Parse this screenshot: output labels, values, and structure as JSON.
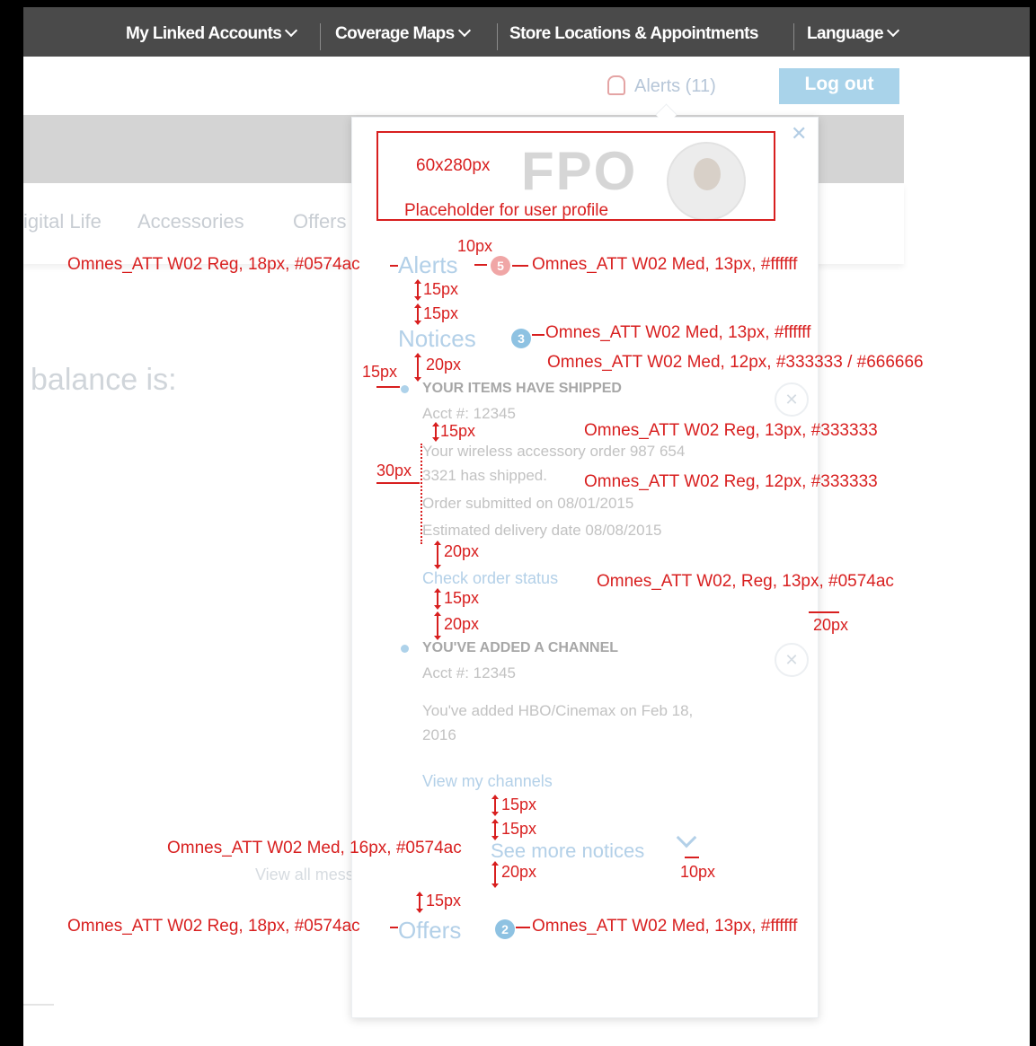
{
  "nav": {
    "linked_accounts": "My Linked Accounts",
    "coverage_maps": "Coverage Maps",
    "store_locations": "Store Locations & Appointments",
    "language": "Language"
  },
  "header": {
    "alerts_link": "Alerts (11)",
    "logout_label": "Log out"
  },
  "background": {
    "tabs": [
      "igital Life",
      "Accessories",
      "Offers"
    ],
    "balance_text": "balance is:",
    "view_all": "View all mess"
  },
  "panel": {
    "close_glyph": "✕",
    "fpo_label": "FPO",
    "alerts_title": "Alerts",
    "alerts_count": "5",
    "notices_title": "Notices",
    "notices_count": "3",
    "notices": [
      {
        "title": "YOUR ITEMS HAVE SHIPPED",
        "account": "Acct #: 12345",
        "body_line1": "Your wireless accessory order 987 654",
        "body_line2": "3321 has shipped.",
        "submitted": "Order submitted on 08/01/2015",
        "delivery": "Estimated delivery date 08/08/2015",
        "link": "Check order status"
      },
      {
        "title": "YOU'VE ADDED A CHANNEL",
        "account": "Acct #: 12345",
        "body_line1": "You've added HBO/Cinemax on Feb 18,",
        "body_line2": "2016",
        "link": "View my channels"
      }
    ],
    "see_more": "See more notices",
    "offers_title": "Offers",
    "offers_count": "2"
  },
  "annotations": {
    "fpo_size": "60x280px",
    "fpo_note": "Placeholder for user profile",
    "alerts_font": "Omnes_ATT W02 Reg, 18px, #0574ac",
    "alerts_gap": "10px",
    "alerts_badge_font": "Omnes_ATT W02 Med, 13px, #ffffff",
    "sp_15a": "15px",
    "sp_15b": "15px",
    "notices_badge_font": "Omnes_ATT W02 Med, 13px, #ffffff",
    "left_15": "15px",
    "sp_20a": "20px",
    "title_font": "Omnes_ATT W02 Med, 12px, #333333 / #666666",
    "sp_15c": "15px",
    "body_font": "Omnes_ATT W02 Reg, 13px, #333333",
    "left_30": "30px",
    "meta_font": "Omnes_ATT W02 Reg, 12px, #333333",
    "sp_20b": "20px",
    "link_font": "Omnes_ATT W02, Reg, 13px, #0574ac",
    "sp_15d": "15px",
    "right_20": "20px",
    "sp_20c": "20px",
    "sp_15e": "15px",
    "sp_15f": "15px",
    "see_more_font": "Omnes_ATT W02 Med, 16px, #0574ac",
    "sp_20d": "20px",
    "chev_gap": "10px",
    "sp_15g": "15px",
    "offers_font": "Omnes_ATT W02 Reg, 18px, #0574ac",
    "offers_badge_font": "Omnes_ATT W02 Med, 13px, #ffffff"
  },
  "colors": {
    "nav_bg": "#4a4a4a",
    "annotation_red": "#d81f1f",
    "accent_blue": "#0574ac",
    "badge_red": "#f0a6a6",
    "badge_blue": "#8ec2e2"
  }
}
